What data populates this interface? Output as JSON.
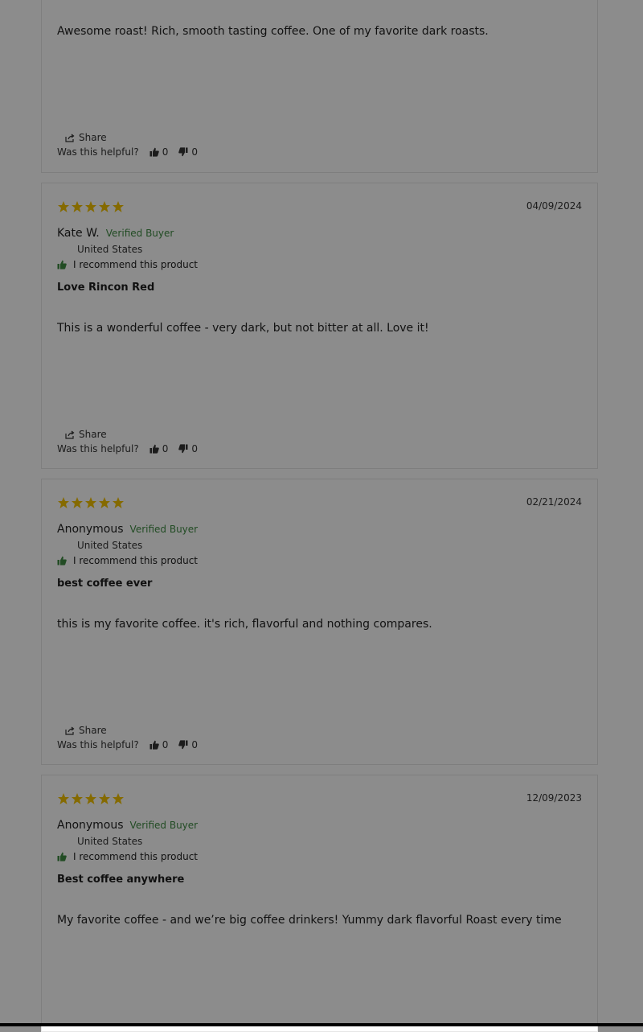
{
  "reviews": [
    {
      "body": "Awesome roast! Rich, smooth tasting coffee. One of my favorite dark roasts.",
      "share_label": "Share",
      "helpful_label": "Was this helpful?",
      "up_count": "0",
      "down_count": "0"
    },
    {
      "rating": 5,
      "date": "04/09/2024",
      "author": "Kate W.",
      "verified": "Verified Buyer",
      "country": "United States",
      "recommend": "I recommend this product",
      "title": "Love Rincon Red",
      "body": "This is a wonderful coffee - very dark, but not bitter at all. Love it!",
      "share_label": "Share",
      "helpful_label": "Was this helpful?",
      "up_count": "0",
      "down_count": "0"
    },
    {
      "rating": 5,
      "date": "02/21/2024",
      "author": "Anonymous",
      "verified": "Verified Buyer",
      "country": "United States",
      "recommend": "I recommend this product",
      "title": "best coffee ever",
      "body": "this is my favorite coffee. it's rich, flavorful and nothing compares.",
      "share_label": "Share",
      "helpful_label": "Was this helpful?",
      "up_count": "0",
      "down_count": "0"
    },
    {
      "rating": 5,
      "date": "12/09/2023",
      "author": "Anonymous",
      "verified": "Verified Buyer",
      "country": "United States",
      "recommend": "I recommend this product",
      "title": "Best coffee anywhere",
      "body": "My favorite coffee - and we’re big coffee drinkers! Yummy dark flavorful Roast every time"
    }
  ],
  "colors": {
    "star": "#f2c200",
    "verified": "#3e8a43",
    "recommend_icon": "#3e8a43",
    "overlay": "rgba(0,0,0,0.45)"
  },
  "icons": {
    "star": "star-icon",
    "share": "share-icon",
    "thumbs_up": "thumbs-up-icon",
    "thumbs_down": "thumbs-down-icon"
  }
}
